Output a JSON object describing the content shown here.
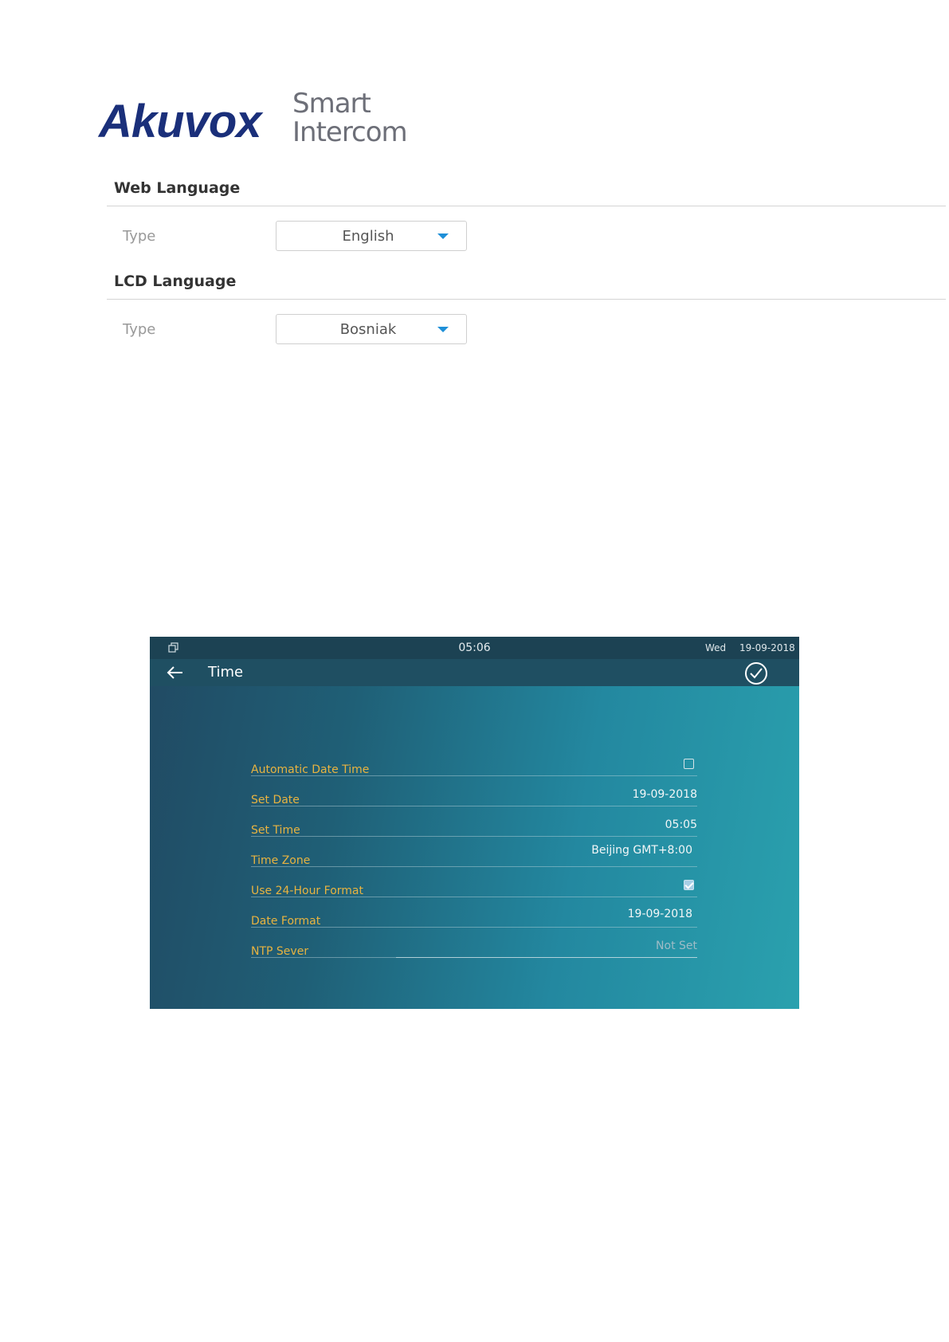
{
  "logo": {
    "brand": "Akuvox",
    "line1": "Smart",
    "line2": "Intercom"
  },
  "web_language": {
    "title": "Web Language",
    "type_label": "Type",
    "value": "English"
  },
  "lcd_language": {
    "title": "LCD Language",
    "type_label": "Type",
    "value": "Bosniak"
  },
  "device": {
    "statusbar": {
      "time": "05:06",
      "day": "Wed",
      "date": "19-09-2018"
    },
    "header": {
      "title": "Time"
    },
    "rows": {
      "auto_date_time": {
        "label": "Automatic Date Time",
        "checked": false
      },
      "set_date": {
        "label": "Set Date",
        "value": "19-09-2018"
      },
      "set_time": {
        "label": "Set Time",
        "value": "05:05"
      },
      "time_zone": {
        "label": "Time Zone",
        "value": "Beijing GMT+8:00"
      },
      "use_24h": {
        "label": "Use 24-Hour Format",
        "checked": true
      },
      "date_format": {
        "label": "Date Format",
        "value": "19-09-2018"
      },
      "ntp_server": {
        "label": "NTP Sever",
        "placeholder": "Not Set"
      }
    }
  },
  "colors": {
    "brand": "#1a2f7a",
    "accent_label": "#e8b340",
    "dropdown_arrow": "#1e8fd8"
  }
}
